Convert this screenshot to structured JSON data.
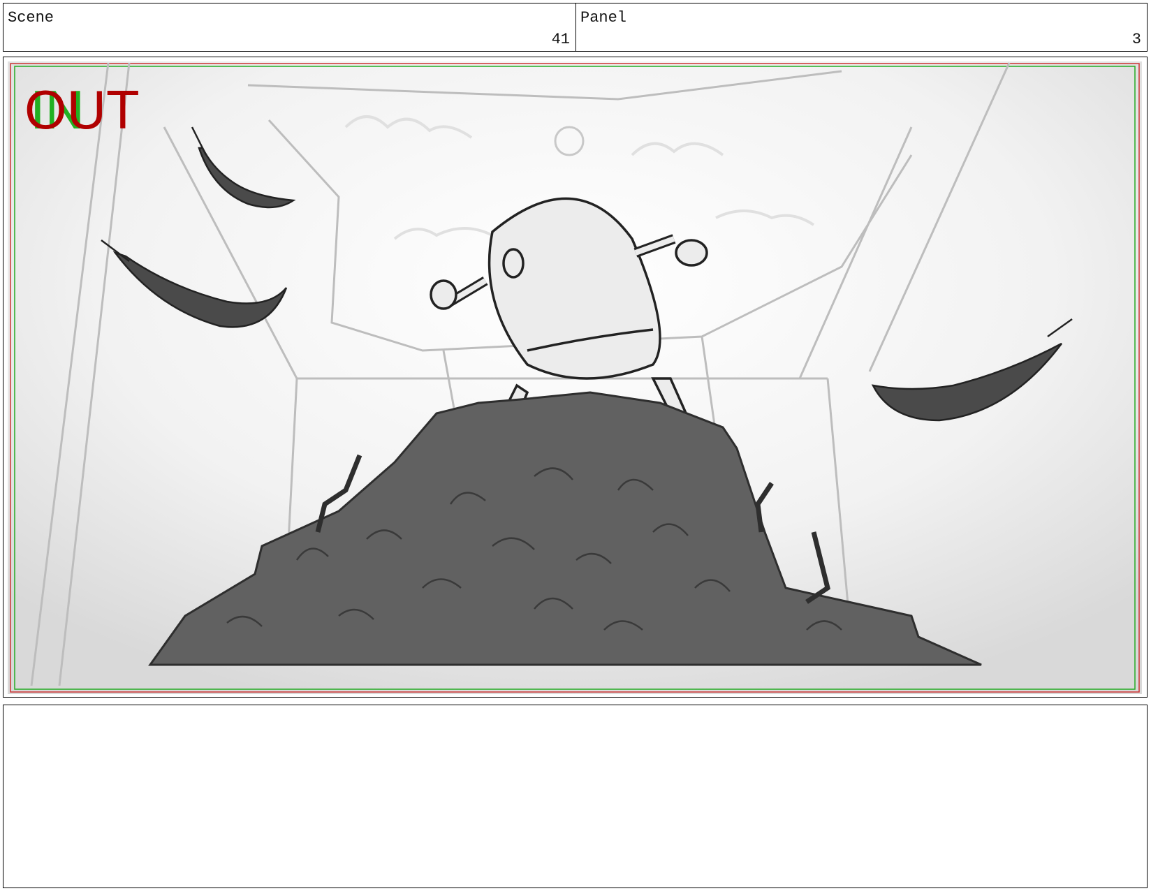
{
  "header": {
    "scene_label": "Scene",
    "scene_number": "41",
    "panel_label": "Panel",
    "panel_number": "3"
  },
  "frame": {
    "in_marker": "IN",
    "out_marker": "OUT",
    "colors": {
      "in": "#22b022",
      "out": "#b00000",
      "pile": "#616161",
      "feather": "#4a4a4a",
      "line": "#222222"
    }
  },
  "notes": {
    "text": ""
  }
}
